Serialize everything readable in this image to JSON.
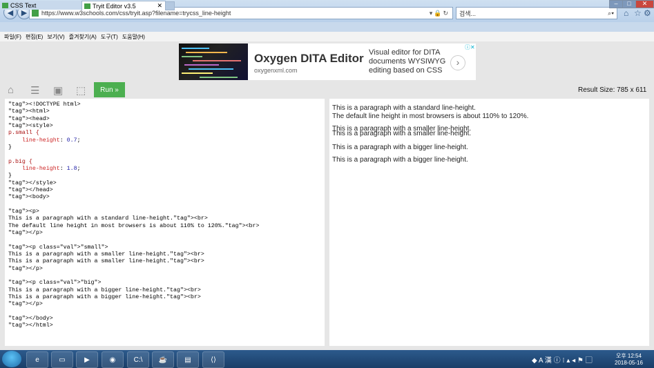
{
  "browser": {
    "url": "https://www.w3schools.com/css/tryit.asp?filename=trycss_line-height",
    "search_placeholder": "검색...",
    "tabs": [
      {
        "label": "CSS Text"
      },
      {
        "label": "Tryit Editor v3.5"
      }
    ],
    "menu": [
      "파일(F)",
      "편집(E)",
      "보기(V)",
      "즐겨찾기(A)",
      "도구(T)",
      "도움말(H)"
    ]
  },
  "ad": {
    "title": "Oxygen DITA Editor",
    "url": "oxygenxml.com",
    "text": "Visual editor for DITA documents WYSIWYG editing based on CSS"
  },
  "toolbar": {
    "run_label": "Run »",
    "result_size": "Result Size: 785 x 611"
  },
  "code_lines": [
    "<!DOCTYPE html>",
    "<html>",
    "<head>",
    "<style>",
    "p.small {",
    "    line-height: 0.7;",
    "}",
    "",
    "p.big {",
    "    line-height: 1.8;",
    "}",
    "</style>",
    "</head>",
    "<body>",
    "",
    "<p>",
    "This is a paragraph with a standard line-height.<br>",
    "The default line height in most browsers is about 110% to 120%.<br>",
    "</p>",
    "",
    "<p class=\"small\">",
    "This is a paragraph with a smaller line-height.<br>",
    "This is a paragraph with a smaller line-height.<br>",
    "</p>",
    "",
    "<p class=\"big\">",
    "This is a paragraph with a bigger line-height.<br>",
    "This is a paragraph with a bigger line-height.<br>",
    "</p>",
    "",
    "</body>",
    "</html>"
  ],
  "result": {
    "p1": [
      "This is a paragraph with a standard line-height.",
      "The default line height in most browsers is about 110% to 120%."
    ],
    "p2": [
      "This is a paragraph with a smaller line-height.",
      "This is a paragraph with a smaller line-height."
    ],
    "p3": [
      "This is a paragraph with a bigger line-height.",
      "This is a paragraph with a bigger line-height."
    ]
  },
  "clock": {
    "time": "오후 12:54",
    "date": "2018-05-16"
  }
}
